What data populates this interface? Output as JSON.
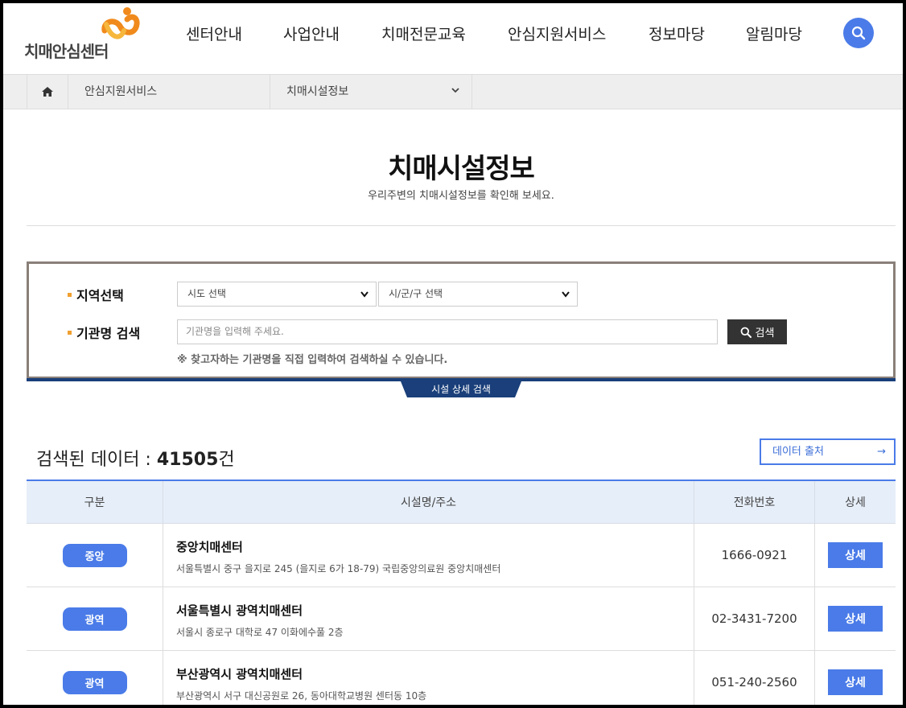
{
  "header": {
    "logo_text": "치매안심센터",
    "nav": [
      "센터안내",
      "사업안내",
      "치매전문교육",
      "안심지원서비스",
      "정보마당",
      "알림마당"
    ]
  },
  "breadcrumb": {
    "level1": "안심지원서비스",
    "level2": "치매시설정보"
  },
  "page": {
    "title": "치매시설정보",
    "subtitle": "우리주변의 치매시설정보를 확인해 보세요."
  },
  "search": {
    "region_label": "지역선택",
    "sido_select": "시도 선택",
    "sigungu_select": "시/군/구 선택",
    "name_label": "기관명 검색",
    "name_placeholder": "기관명을 입력해 주세요.",
    "search_button": "검색",
    "notice": "※ 찾고자하는 기관명을 직접 입력하여 검색하실 수 있습니다.",
    "detail_tab": "시설 상세 검색"
  },
  "results": {
    "count_prefix": "검색된 데이터 : ",
    "count": "41505",
    "count_suffix": "건",
    "export_button": "데이터 출처",
    "headers": [
      "구분",
      "시설명/주소",
      "전화번호",
      "상세"
    ],
    "rows": [
      {
        "type": "중앙",
        "name": "중앙치매센터",
        "address": "서울특별시 중구 을지로 245 (을지로 6가 18-79) 국립중앙의료원 중앙치매센터",
        "phone": "1666-0921",
        "detail": "상세"
      },
      {
        "type": "광역",
        "name": "서울특별시 광역치매센터",
        "address": "서울시 종로구 대학로 47 이화에수풀 2층",
        "phone": "02-3431-7200",
        "detail": "상세"
      },
      {
        "type": "광역",
        "name": "부산광역시 광역치매센터",
        "address": "부산광역시 서구 대신공원로 26, 동아대학교병원 센터동 10층",
        "phone": "051-240-2560",
        "detail": "상세"
      }
    ]
  },
  "colors": {
    "accent": "#4a7be8",
    "dark_navy": "#1a3f7a",
    "logo_orange": "#f08a1c"
  }
}
